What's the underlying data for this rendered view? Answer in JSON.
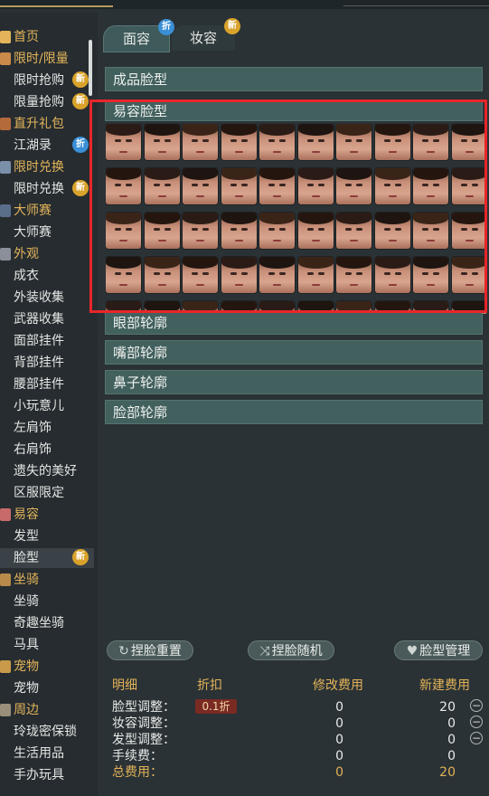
{
  "sidebar": {
    "items": [
      {
        "label": "首页",
        "type": "cat",
        "badge": "",
        "active": false,
        "icon": "home-icon"
      },
      {
        "label": "限时/限量",
        "type": "cat",
        "badge": "",
        "active": false,
        "icon": "gift-icon"
      },
      {
        "label": "限时抢购",
        "type": "item",
        "badge": "新",
        "active": false
      },
      {
        "label": "限量抢购",
        "type": "item",
        "badge": "新",
        "active": false
      },
      {
        "label": "直升礼包",
        "type": "cat",
        "badge": "",
        "active": false,
        "icon": "package-icon"
      },
      {
        "label": "江湖录",
        "type": "item",
        "badge": "折",
        "active": false
      },
      {
        "label": "限时兑换",
        "type": "cat",
        "badge": "",
        "active": false,
        "icon": "exchange-icon"
      },
      {
        "label": "限时兑换",
        "type": "item",
        "badge": "新",
        "active": false
      },
      {
        "label": "大师赛",
        "type": "cat",
        "badge": "",
        "active": false,
        "icon": "trophy-icon"
      },
      {
        "label": "大师赛",
        "type": "item",
        "badge": "",
        "active": false
      },
      {
        "label": "外观",
        "type": "cat",
        "badge": "",
        "active": false,
        "icon": "hanger-icon"
      },
      {
        "label": "成衣",
        "type": "item",
        "badge": "",
        "active": false
      },
      {
        "label": "外装收集",
        "type": "item",
        "badge": "",
        "active": false
      },
      {
        "label": "武器收集",
        "type": "item",
        "badge": "",
        "active": false
      },
      {
        "label": "面部挂件",
        "type": "item",
        "badge": "",
        "active": false
      },
      {
        "label": "背部挂件",
        "type": "item",
        "badge": "",
        "active": false
      },
      {
        "label": "腰部挂件",
        "type": "item",
        "badge": "",
        "active": false
      },
      {
        "label": "小玩意儿",
        "type": "item",
        "badge": "",
        "active": false
      },
      {
        "label": "左肩饰",
        "type": "item",
        "badge": "",
        "active": false
      },
      {
        "label": "右肩饰",
        "type": "item",
        "badge": "",
        "active": false
      },
      {
        "label": "遗失的美好",
        "type": "item",
        "badge": "",
        "active": false
      },
      {
        "label": "区服限定",
        "type": "item",
        "badge": "",
        "active": false
      },
      {
        "label": "易容",
        "type": "cat",
        "badge": "",
        "active": false,
        "icon": "mask-icon"
      },
      {
        "label": "发型",
        "type": "item",
        "badge": "",
        "active": false
      },
      {
        "label": "脸型",
        "type": "item",
        "badge": "新",
        "active": true
      },
      {
        "label": "坐骑",
        "type": "cat",
        "badge": "",
        "active": false,
        "icon": "horse-icon"
      },
      {
        "label": "坐骑",
        "type": "item",
        "badge": "",
        "active": false
      },
      {
        "label": "奇趣坐骑",
        "type": "item",
        "badge": "",
        "active": false
      },
      {
        "label": "马具",
        "type": "item",
        "badge": "",
        "active": false
      },
      {
        "label": "宠物",
        "type": "cat",
        "badge": "",
        "active": false,
        "icon": "paw-icon"
      },
      {
        "label": "宠物",
        "type": "item",
        "badge": "",
        "active": false
      },
      {
        "label": "周边",
        "type": "cat",
        "badge": "",
        "active": false,
        "icon": "shop-icon"
      },
      {
        "label": "玲珑密保锁",
        "type": "item",
        "badge": "",
        "active": false
      },
      {
        "label": "生活用品",
        "type": "item",
        "badge": "",
        "active": false
      },
      {
        "label": "手办玩具",
        "type": "item",
        "badge": "",
        "active": false
      }
    ]
  },
  "tabs": [
    {
      "label": "面容",
      "badge": "折"
    },
    {
      "label": "妆容",
      "badge": "新"
    }
  ],
  "sections": {
    "preset": "成品脸型",
    "custom": "易容脸型",
    "eye": "眼部轮廓",
    "mouth": "嘴部轮廓",
    "nose": "鼻子轮廓",
    "face": "脸部轮廓"
  },
  "faces": {
    "rows": 4,
    "cols": 10
  },
  "actions": {
    "reset": "捏脸重置",
    "random": "捏脸随机",
    "manage": "脸型管理"
  },
  "cost": {
    "headers": {
      "detail": "明细",
      "discount": "折扣",
      "modify": "修改费用",
      "new": "新建费用"
    },
    "discount_badge": "0.1折",
    "rows": [
      {
        "label": "脸型调整：",
        "modify": "0",
        "new": "20"
      },
      {
        "label": "妆容调整：",
        "modify": "0",
        "new": "0"
      },
      {
        "label": "发型调整：",
        "modify": "0",
        "new": "0"
      },
      {
        "label": "手续费：",
        "modify": "0",
        "new": "0"
      }
    ],
    "total": {
      "label": "总费用：",
      "modify": "0",
      "new": "20"
    }
  },
  "colors": {
    "accent": "#e2b257",
    "panel": "#41605e",
    "highlight": "#e8262a"
  }
}
